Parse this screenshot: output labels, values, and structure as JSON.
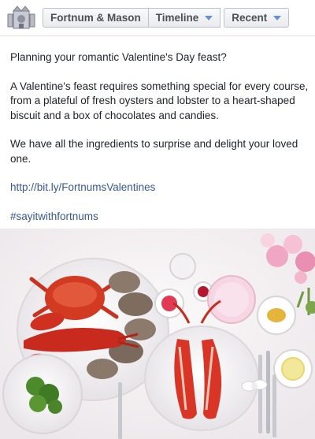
{
  "header": {
    "page_name": "Fortnum & Mason",
    "timeline_label": "Timeline",
    "recent_label": "Recent",
    "crest_icon": "crest-icon",
    "caret_icon": "caret-down-icon",
    "caret_color": "#6a8fce"
  },
  "post": {
    "heading": "Planning your romantic Valentine's Day feast?",
    "paragraph": "A Valentine's feast requires something special for every course, from a plateful of fresh oysters and lobster to a heart-shaped biscuit and a box of chocolates and candies.",
    "delight": "We have all the ingredients to surprise and delight your loved one.",
    "link": "http://bit.ly/FortnumsValentines",
    "hashtag": "#sayitwithfortnums",
    "link_color": "#365899"
  },
  "photo": {
    "subject": "table-setting-with-lobster-oysters-and-flowers"
  }
}
